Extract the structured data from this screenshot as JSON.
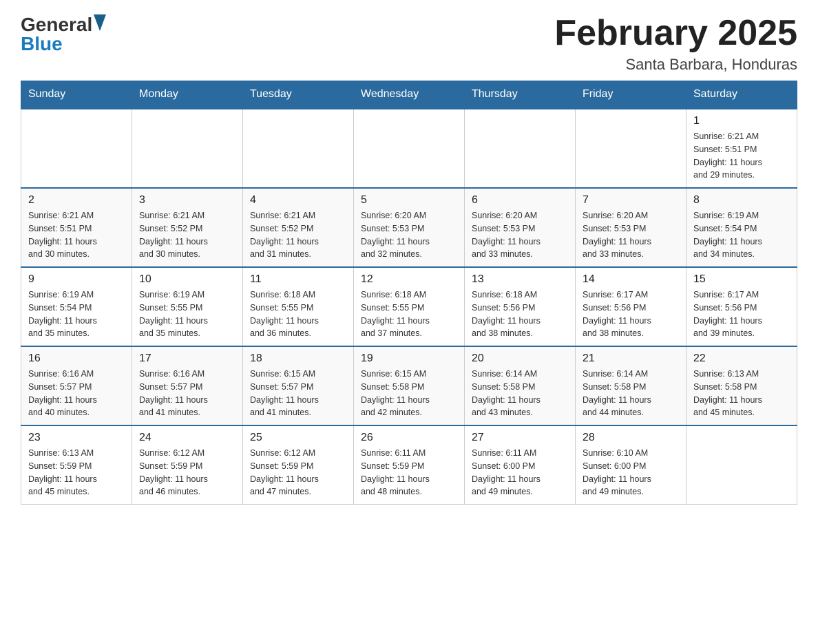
{
  "header": {
    "month_year": "February 2025",
    "location": "Santa Barbara, Honduras",
    "logo_general": "General",
    "logo_blue": "Blue"
  },
  "days_of_week": [
    "Sunday",
    "Monday",
    "Tuesday",
    "Wednesday",
    "Thursday",
    "Friday",
    "Saturday"
  ],
  "weeks": [
    {
      "days": [
        {
          "date": "",
          "info": ""
        },
        {
          "date": "",
          "info": ""
        },
        {
          "date": "",
          "info": ""
        },
        {
          "date": "",
          "info": ""
        },
        {
          "date": "",
          "info": ""
        },
        {
          "date": "",
          "info": ""
        },
        {
          "date": "1",
          "info": "Sunrise: 6:21 AM\nSunset: 5:51 PM\nDaylight: 11 hours\nand 29 minutes."
        }
      ]
    },
    {
      "days": [
        {
          "date": "2",
          "info": "Sunrise: 6:21 AM\nSunset: 5:51 PM\nDaylight: 11 hours\nand 30 minutes."
        },
        {
          "date": "3",
          "info": "Sunrise: 6:21 AM\nSunset: 5:52 PM\nDaylight: 11 hours\nand 30 minutes."
        },
        {
          "date": "4",
          "info": "Sunrise: 6:21 AM\nSunset: 5:52 PM\nDaylight: 11 hours\nand 31 minutes."
        },
        {
          "date": "5",
          "info": "Sunrise: 6:20 AM\nSunset: 5:53 PM\nDaylight: 11 hours\nand 32 minutes."
        },
        {
          "date": "6",
          "info": "Sunrise: 6:20 AM\nSunset: 5:53 PM\nDaylight: 11 hours\nand 33 minutes."
        },
        {
          "date": "7",
          "info": "Sunrise: 6:20 AM\nSunset: 5:53 PM\nDaylight: 11 hours\nand 33 minutes."
        },
        {
          "date": "8",
          "info": "Sunrise: 6:19 AM\nSunset: 5:54 PM\nDaylight: 11 hours\nand 34 minutes."
        }
      ]
    },
    {
      "days": [
        {
          "date": "9",
          "info": "Sunrise: 6:19 AM\nSunset: 5:54 PM\nDaylight: 11 hours\nand 35 minutes."
        },
        {
          "date": "10",
          "info": "Sunrise: 6:19 AM\nSunset: 5:55 PM\nDaylight: 11 hours\nand 35 minutes."
        },
        {
          "date": "11",
          "info": "Sunrise: 6:18 AM\nSunset: 5:55 PM\nDaylight: 11 hours\nand 36 minutes."
        },
        {
          "date": "12",
          "info": "Sunrise: 6:18 AM\nSunset: 5:55 PM\nDaylight: 11 hours\nand 37 minutes."
        },
        {
          "date": "13",
          "info": "Sunrise: 6:18 AM\nSunset: 5:56 PM\nDaylight: 11 hours\nand 38 minutes."
        },
        {
          "date": "14",
          "info": "Sunrise: 6:17 AM\nSunset: 5:56 PM\nDaylight: 11 hours\nand 38 minutes."
        },
        {
          "date": "15",
          "info": "Sunrise: 6:17 AM\nSunset: 5:56 PM\nDaylight: 11 hours\nand 39 minutes."
        }
      ]
    },
    {
      "days": [
        {
          "date": "16",
          "info": "Sunrise: 6:16 AM\nSunset: 5:57 PM\nDaylight: 11 hours\nand 40 minutes."
        },
        {
          "date": "17",
          "info": "Sunrise: 6:16 AM\nSunset: 5:57 PM\nDaylight: 11 hours\nand 41 minutes."
        },
        {
          "date": "18",
          "info": "Sunrise: 6:15 AM\nSunset: 5:57 PM\nDaylight: 11 hours\nand 41 minutes."
        },
        {
          "date": "19",
          "info": "Sunrise: 6:15 AM\nSunset: 5:58 PM\nDaylight: 11 hours\nand 42 minutes."
        },
        {
          "date": "20",
          "info": "Sunrise: 6:14 AM\nSunset: 5:58 PM\nDaylight: 11 hours\nand 43 minutes."
        },
        {
          "date": "21",
          "info": "Sunrise: 6:14 AM\nSunset: 5:58 PM\nDaylight: 11 hours\nand 44 minutes."
        },
        {
          "date": "22",
          "info": "Sunrise: 6:13 AM\nSunset: 5:58 PM\nDaylight: 11 hours\nand 45 minutes."
        }
      ]
    },
    {
      "days": [
        {
          "date": "23",
          "info": "Sunrise: 6:13 AM\nSunset: 5:59 PM\nDaylight: 11 hours\nand 45 minutes."
        },
        {
          "date": "24",
          "info": "Sunrise: 6:12 AM\nSunset: 5:59 PM\nDaylight: 11 hours\nand 46 minutes."
        },
        {
          "date": "25",
          "info": "Sunrise: 6:12 AM\nSunset: 5:59 PM\nDaylight: 11 hours\nand 47 minutes."
        },
        {
          "date": "26",
          "info": "Sunrise: 6:11 AM\nSunset: 5:59 PM\nDaylight: 11 hours\nand 48 minutes."
        },
        {
          "date": "27",
          "info": "Sunrise: 6:11 AM\nSunset: 6:00 PM\nDaylight: 11 hours\nand 49 minutes."
        },
        {
          "date": "28",
          "info": "Sunrise: 6:10 AM\nSunset: 6:00 PM\nDaylight: 11 hours\nand 49 minutes."
        },
        {
          "date": "",
          "info": ""
        }
      ]
    }
  ]
}
